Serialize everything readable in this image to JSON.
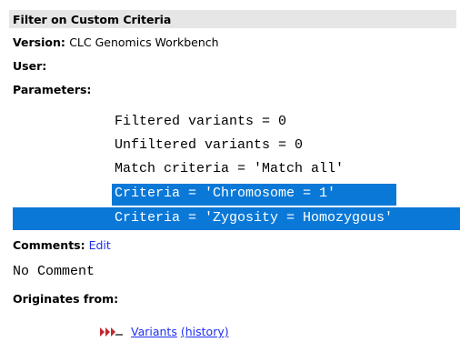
{
  "header": {
    "title": "Filter on Custom Criteria"
  },
  "info": {
    "version_label": "Version:",
    "version_value": "CLC Genomics Workbench",
    "user_label": "User:",
    "parameters_label": "Parameters:"
  },
  "parameters": [
    "Filtered variants = 0",
    "Unfiltered variants = 0",
    "Match criteria = 'Match all'",
    "Criteria = 'Chromosome = 1'",
    "Criteria = 'Zygosity = Homozygous'"
  ],
  "comments": {
    "label": "Comments:",
    "edit_link": "Edit",
    "text": "No Comment"
  },
  "originates": {
    "label": "Originates from:",
    "item_name": "Variants",
    "history_link": "(history)",
    "icon": "variant-track-icon"
  },
  "colors": {
    "selection": "#0a78d7",
    "link": "#1f2ff0",
    "header_bg": "#e6e6e6",
    "icon_red": "#c0282d"
  }
}
